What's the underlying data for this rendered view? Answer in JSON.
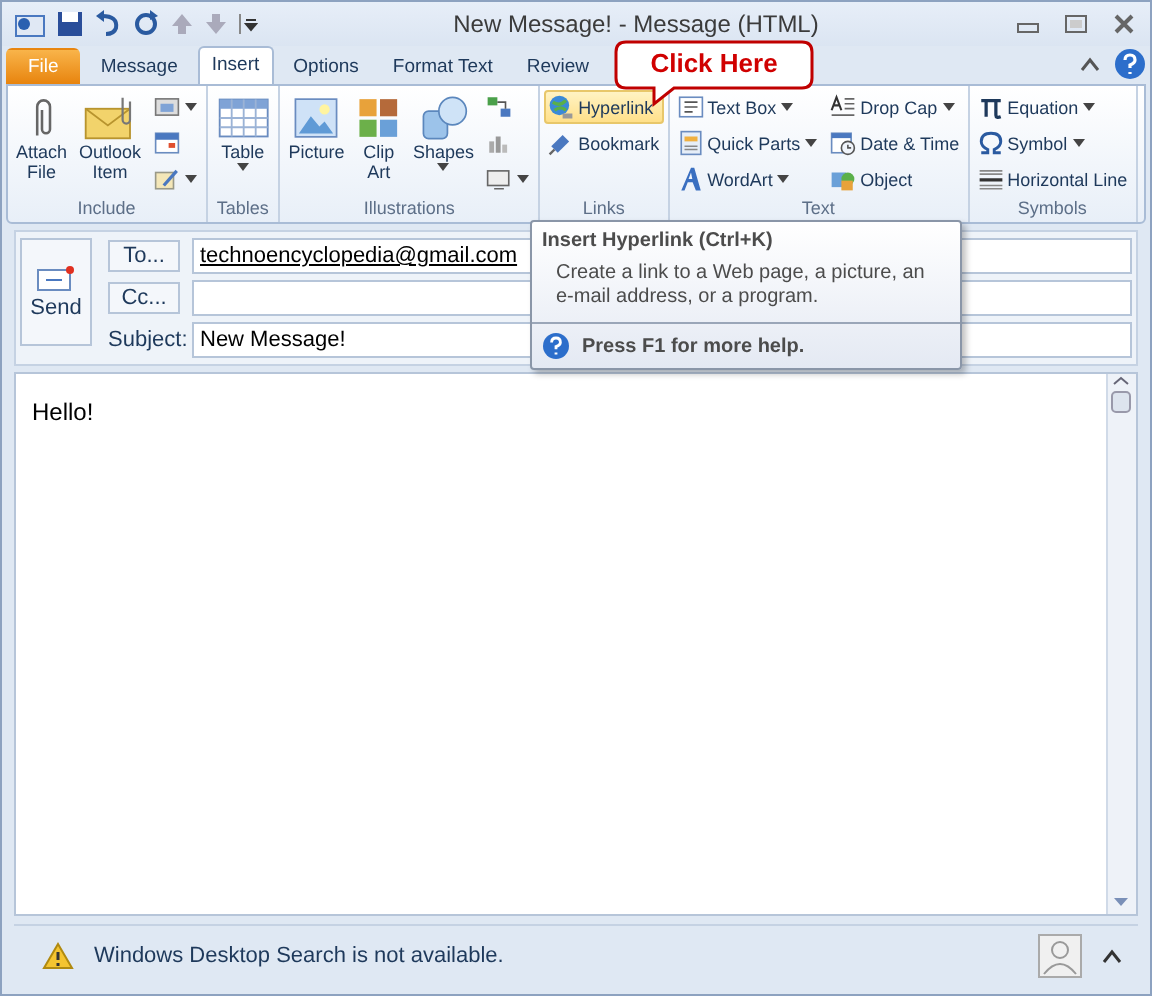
{
  "window": {
    "title": "New Message! - Message (HTML)"
  },
  "tabs": [
    {
      "label": "File",
      "kind": "file",
      "selected": false
    },
    {
      "label": "Message",
      "kind": "tab",
      "selected": false
    },
    {
      "label": "Insert",
      "kind": "tab",
      "selected": true
    },
    {
      "label": "Options",
      "kind": "tab",
      "selected": false
    },
    {
      "label": "Format Text",
      "kind": "tab",
      "selected": false
    },
    {
      "label": "Review",
      "kind": "tab",
      "selected": false
    }
  ],
  "ribbon": {
    "groups": [
      {
        "label": "Include",
        "items": [
          {
            "label": "Attach File",
            "kind": "large",
            "dropdown": false,
            "hovered": false
          },
          {
            "label": "Outlook Item",
            "kind": "large",
            "dropdown": false,
            "hovered": false
          },
          {
            "kind": "icon",
            "dropdown": true,
            "hovered": false
          },
          {
            "kind": "icon",
            "dropdown": false,
            "hovered": false
          },
          {
            "kind": "icon",
            "dropdown": true,
            "hovered": false
          }
        ]
      },
      {
        "label": "Tables",
        "items": [
          {
            "label": "Table",
            "kind": "large",
            "dropdown": true,
            "hovered": false
          }
        ]
      },
      {
        "label": "Illustrations",
        "items": [
          {
            "label": "Picture",
            "kind": "large",
            "dropdown": false,
            "hovered": false
          },
          {
            "label": "Clip Art",
            "kind": "large",
            "dropdown": false,
            "hovered": false
          },
          {
            "label": "Shapes",
            "kind": "large",
            "dropdown": true,
            "hovered": false
          },
          {
            "kind": "icon",
            "dropdown": false,
            "hovered": false
          },
          {
            "kind": "icon",
            "dropdown": false,
            "hovered": false
          },
          {
            "kind": "icon",
            "dropdown": true,
            "hovered": false
          }
        ]
      },
      {
        "label": "Links",
        "items": [
          {
            "label": "Hyperlink",
            "kind": "small",
            "dropdown": false,
            "hovered": true
          },
          {
            "label": "Bookmark",
            "kind": "small",
            "dropdown": false,
            "hovered": false
          }
        ]
      },
      {
        "label": "Text",
        "items": [
          {
            "label": "Text Box",
            "kind": "small",
            "dropdown": true,
            "hovered": false
          },
          {
            "label": "Quick Parts",
            "kind": "small",
            "dropdown": true,
            "hovered": false
          },
          {
            "label": "WordArt",
            "kind": "small",
            "dropdown": true,
            "hovered": false
          },
          {
            "label": "Drop Cap",
            "kind": "small",
            "dropdown": true,
            "hovered": false
          },
          {
            "label": "Date & Time",
            "kind": "small",
            "dropdown": false,
            "hovered": false
          },
          {
            "label": "Object",
            "kind": "small",
            "dropdown": false,
            "hovered": false
          }
        ]
      },
      {
        "label": "Symbols",
        "items": [
          {
            "label": "Equation",
            "kind": "small",
            "dropdown": true,
            "hovered": false
          },
          {
            "label": "Symbol",
            "kind": "small",
            "dropdown": true,
            "hovered": false
          },
          {
            "label": "Horizontal Line",
            "kind": "small",
            "dropdown": false,
            "hovered": false
          }
        ]
      }
    ]
  },
  "callout": {
    "text": "Click Here"
  },
  "tooltip": {
    "title": "Insert Hyperlink (Ctrl+K)",
    "text": "Create a link to a Web page, a picture, an e-mail address, or a program.",
    "help": "Press F1 for more help."
  },
  "compose": {
    "send": "Send",
    "to": {
      "label": "To...",
      "value": "technoencyclopedia@gmail.com"
    },
    "cc": {
      "label": "Cc..."
    },
    "subject": {
      "label": "Subject:",
      "value": "New Message!"
    },
    "body": "Hello!"
  },
  "status_bar": {
    "text": "Windows Desktop Search is not available."
  }
}
